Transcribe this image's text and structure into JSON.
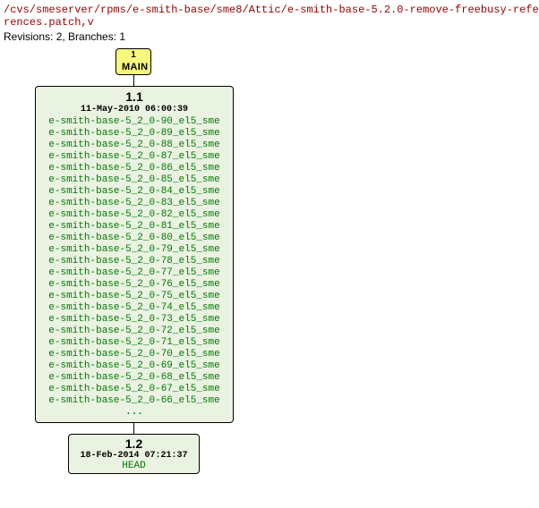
{
  "path": "/cvs/smeserver/rpms/e-smith-base/sme8/Attic/e-smith-base-5.2.0-remove-freebusy-references.patch,v",
  "meta": "Revisions: 2, Branches: 1",
  "main": {
    "num": "1",
    "label": "MAIN"
  },
  "rev11": {
    "title": "1.1",
    "timestamp": "11-May-2010 06:00:39",
    "tags": [
      "e-smith-base-5_2_0-90_el5_sme",
      "e-smith-base-5_2_0-89_el5_sme",
      "e-smith-base-5_2_0-88_el5_sme",
      "e-smith-base-5_2_0-87_el5_sme",
      "e-smith-base-5_2_0-86_el5_sme",
      "e-smith-base-5_2_0-85_el5_sme",
      "e-smith-base-5_2_0-84_el5_sme",
      "e-smith-base-5_2_0-83_el5_sme",
      "e-smith-base-5_2_0-82_el5_sme",
      "e-smith-base-5_2_0-81_el5_sme",
      "e-smith-base-5_2_0-80_el5_sme",
      "e-smith-base-5_2_0-79_el5_sme",
      "e-smith-base-5_2_0-78_el5_sme",
      "e-smith-base-5_2_0-77_el5_sme",
      "e-smith-base-5_2_0-76_el5_sme",
      "e-smith-base-5_2_0-75_el5_sme",
      "e-smith-base-5_2_0-74_el5_sme",
      "e-smith-base-5_2_0-73_el5_sme",
      "e-smith-base-5_2_0-72_el5_sme",
      "e-smith-base-5_2_0-71_el5_sme",
      "e-smith-base-5_2_0-70_el5_sme",
      "e-smith-base-5_2_0-69_el5_sme",
      "e-smith-base-5_2_0-68_el5_sme",
      "e-smith-base-5_2_0-67_el5_sme",
      "e-smith-base-5_2_0-66_el5_sme"
    ],
    "ellipsis": "..."
  },
  "rev12": {
    "title": "1.2",
    "timestamp": "18-Feb-2014 07:21:37",
    "head": "HEAD"
  }
}
